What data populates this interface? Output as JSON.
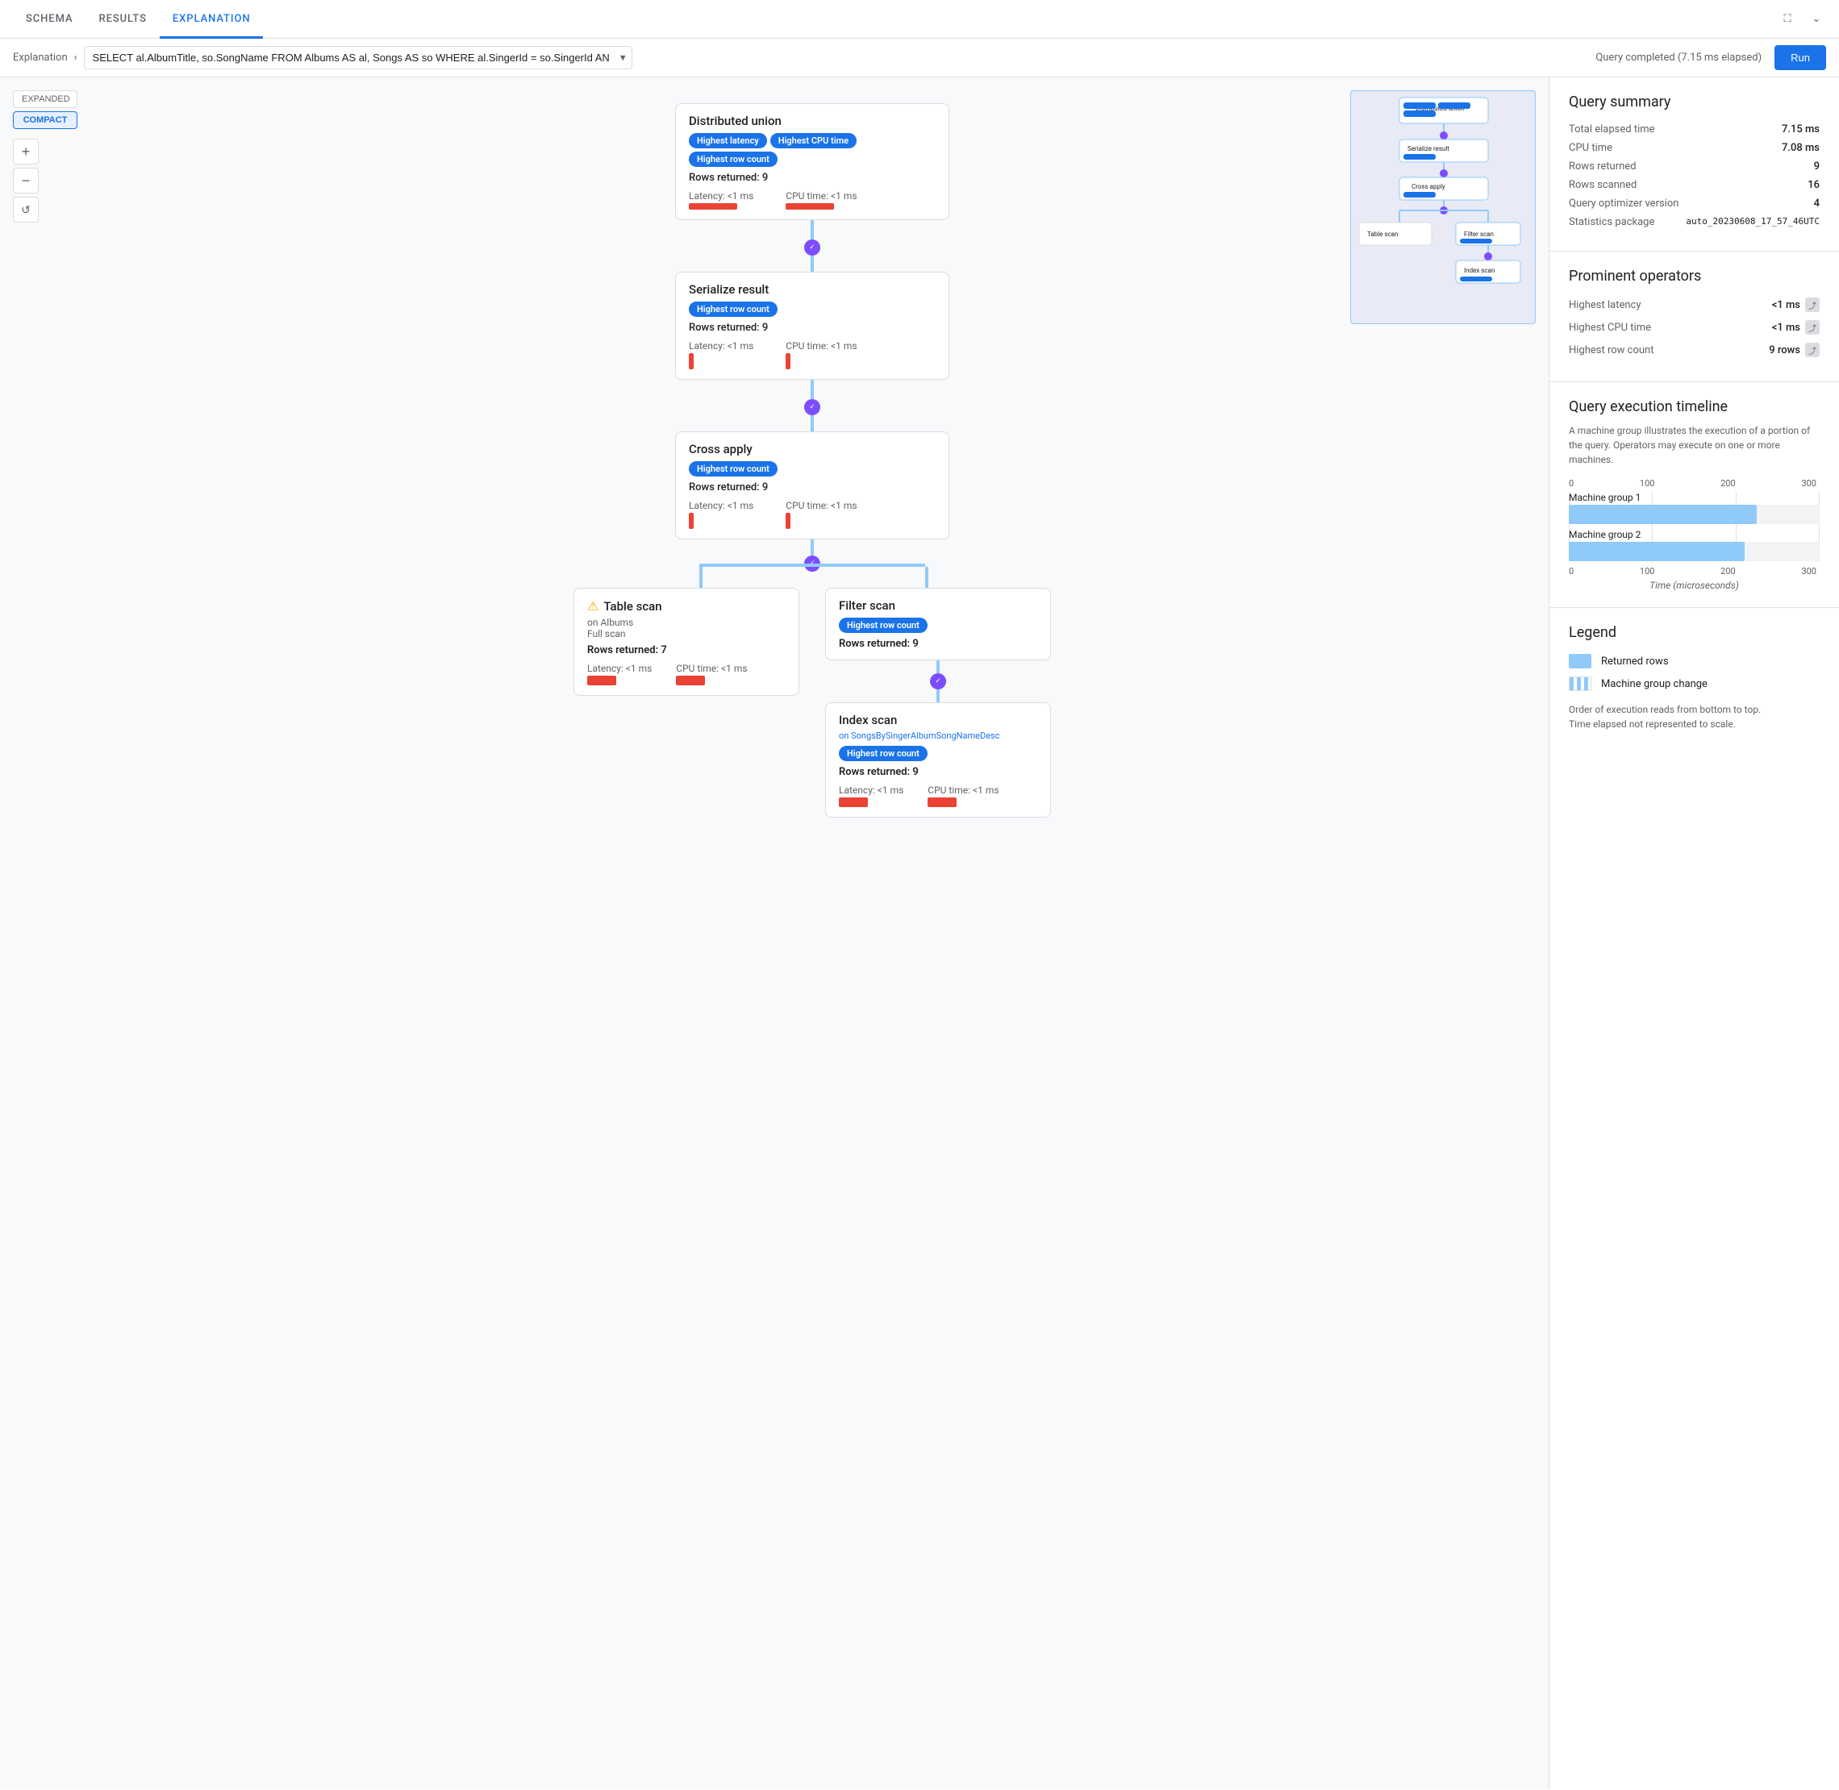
{
  "tabs": [
    {
      "label": "SCHEMA",
      "active": false
    },
    {
      "label": "RESULTS",
      "active": false
    },
    {
      "label": "EXPLANATION",
      "active": true
    }
  ],
  "toolbar": {
    "breadcrumb": "Explanation",
    "query_text": "SELECT al.AlbumTitle, so.SongName FROM Albums AS al, Songs AS so WHERE al.SingerId = so.SingerId AND al.AlbumId = so.Alb…",
    "query_status": "Query completed (7.15 ms elapsed)",
    "run_label": "Run"
  },
  "view_toggle": {
    "expanded_label": "EXPANDED",
    "compact_label": "COMPACT"
  },
  "zoom": {
    "plus": "+",
    "minus": "−",
    "reset": "↺"
  },
  "operators": {
    "distributed_union": {
      "title": "Distributed union",
      "tags": [
        "Highest latency",
        "Highest CPU time",
        "Highest row count"
      ],
      "rows_returned": "Rows returned: 9",
      "latency": "Latency: <1 ms",
      "cpu_time": "CPU time: <1 ms"
    },
    "serialize_result": {
      "title": "Serialize result",
      "tags": [
        "Highest row count"
      ],
      "rows_returned": "Rows returned: 9",
      "latency": "Latency: <1 ms",
      "cpu_time": "CPU time: <1 ms"
    },
    "cross_apply": {
      "title": "Cross apply",
      "tags": [
        "Highest row count"
      ],
      "rows_returned": "Rows returned: 9",
      "latency": "Latency: <1 ms",
      "cpu_time": "CPU time: <1 ms"
    },
    "table_scan": {
      "title": "Table scan",
      "subtitle_on": "on Albums",
      "subtitle_type": "Full scan",
      "rows_returned": "Rows returned: 7",
      "latency": "Latency: <1 ms",
      "cpu_time": "CPU time: <1 ms",
      "warning": true
    },
    "filter_scan": {
      "title": "Filter scan",
      "tags": [
        "Highest row count"
      ],
      "rows_returned": "Rows returned: 9",
      "latency": "",
      "cpu_time": ""
    },
    "index_scan": {
      "title": "Index scan",
      "subtitle_on": "on SongsBySingerAlbumSongNameDesc",
      "tags": [
        "Highest row count"
      ],
      "rows_returned": "Rows returned: 9",
      "latency": "Latency: <1 ms",
      "cpu_time": "CPU time: <1 ms"
    }
  },
  "query_summary": {
    "title": "Query summary",
    "rows": [
      {
        "key": "Total elapsed time",
        "value": "7.15 ms"
      },
      {
        "key": "CPU time",
        "value": "7.08 ms"
      },
      {
        "key": "Rows returned",
        "value": "9"
      },
      {
        "key": "Rows scanned",
        "value": "16"
      },
      {
        "key": "Query optimizer version",
        "value": "4"
      },
      {
        "key": "Statistics package",
        "value": "auto_20230608_17_57_46UTC"
      }
    ]
  },
  "prominent_operators": {
    "title": "Prominent operators",
    "rows": [
      {
        "key": "Highest latency",
        "value": "<1 ms"
      },
      {
        "key": "Highest CPU time",
        "value": "<1 ms"
      },
      {
        "key": "Highest row count",
        "value": "9 rows"
      }
    ]
  },
  "query_execution_timeline": {
    "title": "Query execution timeline",
    "description": "A machine group illustrates the execution of a portion of the query.\nOperators may execute on one or more machines.",
    "axis_labels": [
      "0",
      "100",
      "200",
      "300"
    ],
    "bars": [
      {
        "label": "Machine group 1",
        "fill_pct": 75,
        "striped": false
      },
      {
        "label": "Machine group 2",
        "fill_pct": 70,
        "striped": false
      }
    ],
    "axis_labels_bottom": [
      "0",
      "100",
      "200",
      "300"
    ],
    "x_axis_label": "Time (microseconds)"
  },
  "legend": {
    "title": "Legend",
    "items": [
      {
        "label": "Returned rows",
        "striped": false
      },
      {
        "label": "Machine group change",
        "striped": true
      }
    ],
    "note1": "Order of execution reads from bottom to top.",
    "note2": "Time elapsed not represented to scale."
  }
}
